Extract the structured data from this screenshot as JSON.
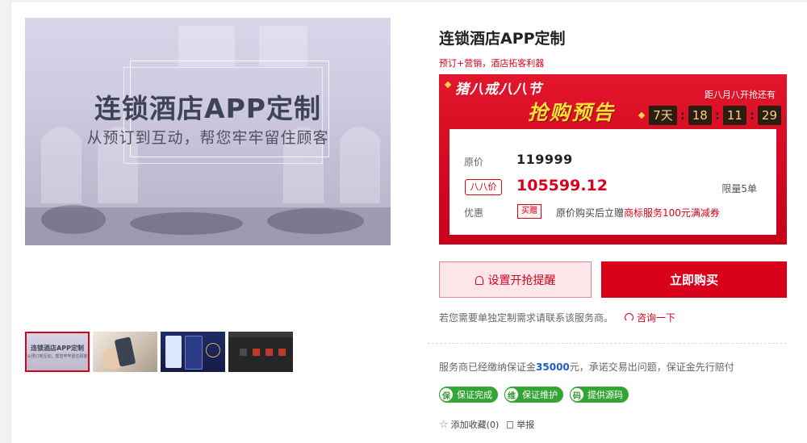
{
  "hero": {
    "title": "连锁酒店APP定制",
    "subtitle": "从预订到互动，帮您牢牢留住顾客"
  },
  "thumbnails": [
    {
      "title": "连锁酒店APP定制",
      "subtitle": "从预订到互动，帮您牢牢留住顾客"
    },
    {},
    {},
    {}
  ],
  "product": {
    "title": "连锁酒店APP定制",
    "slogan": "预订+营销，酒店拓客利器"
  },
  "promo": {
    "banner_line1": "猪八戒八八节",
    "banner_line2": "抢购预告",
    "countdown_label": "距八月八开抢还有",
    "countdown": {
      "days": "7天",
      "hours": "18",
      "minutes": "11",
      "seconds": "29"
    },
    "original_price_label": "原价",
    "original_price": "119999",
    "sale_label": "八八价",
    "sale_price": "105599.12",
    "limit": "限量5单",
    "benefit_label": "优惠",
    "benefit_tag": "买赠",
    "benefit_text_before": "原价购买后立赠",
    "benefit_link": "商标服务100元满减券"
  },
  "actions": {
    "remind_label": "设置开抢提醒",
    "buy_label": "立即购买"
  },
  "consult": {
    "text": "若您需要单独定制需求请联系该服务商。",
    "link": "咨询一下"
  },
  "deposit": {
    "prefix": "服务商已经缴纳保证金",
    "amount": "35000",
    "suffix": "元，承诺交易出问题，保证金先行赔付"
  },
  "guarantees": [
    {
      "icon_char": "保",
      "label": "保证完成"
    },
    {
      "icon_char": "维",
      "label": "保证维护"
    },
    {
      "icon_char": "码",
      "label": "提供源码"
    }
  ],
  "footer": {
    "favorite": "添加收藏(0)",
    "report": "举报"
  },
  "colors": {
    "accent": "#d9001b",
    "deposit_amount": "#1f5fbf",
    "guarantee_green": "#33a534"
  }
}
